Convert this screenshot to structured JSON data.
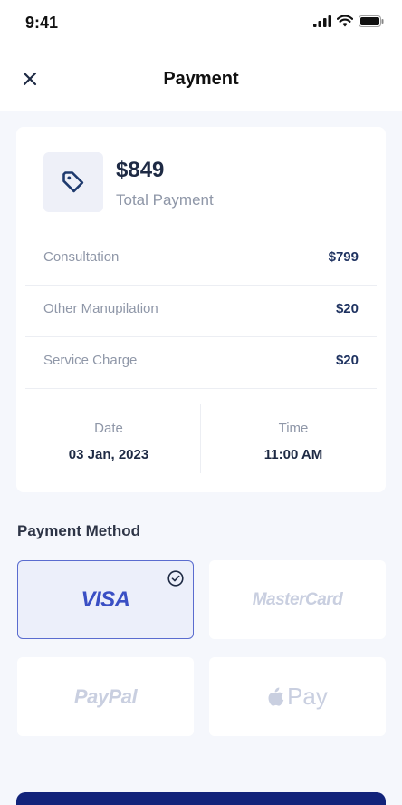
{
  "status_bar": {
    "time": "9:41",
    "icons": [
      "cellular-signal-icon",
      "wifi-icon",
      "battery-icon"
    ]
  },
  "header": {
    "close_icon": "close-icon",
    "title": "Payment"
  },
  "summary": {
    "icon": "price-tag-icon",
    "total_amount": "$849",
    "total_label": "Total Payment",
    "fees": [
      {
        "name": "Consultation",
        "value": "$799"
      },
      {
        "name": "Other Manupilation",
        "value": "$20"
      },
      {
        "name": "Service Charge",
        "value": "$20"
      }
    ],
    "date_label": "Date",
    "date_value": "03 Jan, 2023",
    "time_label": "Time",
    "time_value": "11:00 AM"
  },
  "payment_method": {
    "title": "Payment Method",
    "options": [
      {
        "label": "VISA",
        "selected": true
      },
      {
        "label": "MasterCard",
        "selected": false
      },
      {
        "label": "PayPal",
        "selected": false
      },
      {
        "label": "Pay",
        "selected": false
      }
    ],
    "selected_icon": "check-circle-icon",
    "apple_icon": "apple-icon"
  },
  "colors": {
    "accent": "#12237a",
    "selected_border": "#5a6ccf",
    "selected_bg": "#eceffa",
    "muted_logo": "#c9cfe0",
    "background": "#f5f7fc"
  }
}
